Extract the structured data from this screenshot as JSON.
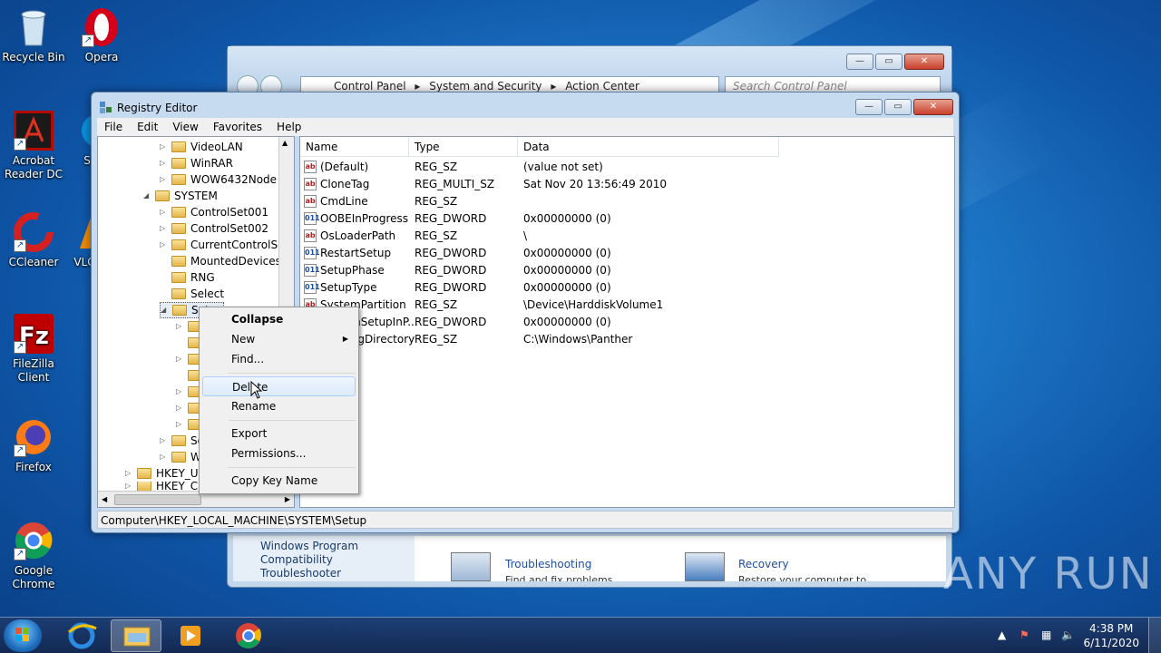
{
  "desktop": {
    "icons": [
      {
        "label": "Recycle Bin",
        "icon": "recycle-bin-icon"
      },
      {
        "label": "Opera",
        "icon": "opera-icon"
      },
      {
        "label": "Acrobat Reader DC",
        "icon": "acrobat-icon"
      },
      {
        "label": "S",
        "icon": "skype-icon"
      },
      {
        "label": "CCleaner",
        "icon": "ccleaner-icon"
      },
      {
        "label": "VLC",
        "icon": "vlc-icon"
      },
      {
        "label": "FileZilla Client",
        "icon": "filezilla-icon"
      },
      {
        "label": "Firefox",
        "icon": "firefox-icon"
      },
      {
        "label": "Google Chrome",
        "icon": "chrome-icon"
      }
    ]
  },
  "control_panel": {
    "address": [
      "Control Panel",
      "System and Security",
      "Action Center"
    ],
    "search_placeholder": "Search Control Panel",
    "left_link": "Windows Program Compatibility Troubleshooter",
    "troubleshooting": {
      "title": "Troubleshooting",
      "sub": "Find and fix problems"
    },
    "recovery": {
      "title": "Recovery",
      "sub": "Restore your computer to"
    }
  },
  "registry": {
    "title": "Registry Editor",
    "menu": [
      "File",
      "Edit",
      "View",
      "Favorites",
      "Help"
    ],
    "tree": [
      {
        "label": "VideoLAN",
        "exp": "▷"
      },
      {
        "label": "WinRAR",
        "exp": "▷"
      },
      {
        "label": "WOW6432Node",
        "exp": "▷"
      },
      {
        "label": "SYSTEM",
        "exp": "◢"
      },
      {
        "label": "ControlSet001",
        "exp": "▷"
      },
      {
        "label": "ControlSet002",
        "exp": "▷"
      },
      {
        "label": "CurrentControlSet",
        "exp": "▷"
      },
      {
        "label": "MountedDevices",
        "exp": ""
      },
      {
        "label": "RNG",
        "exp": ""
      },
      {
        "label": "Select",
        "exp": ""
      },
      {
        "label": "Setup",
        "exp": "◢"
      },
      {
        "label": "So",
        "exp": "▷"
      },
      {
        "label": "W",
        "exp": "▷"
      },
      {
        "label": "HKEY_US",
        "exp": "▷"
      },
      {
        "label": "HKEY_CU",
        "exp": "▷"
      }
    ],
    "columns": [
      "Name",
      "Type",
      "Data"
    ],
    "values": [
      {
        "name": "(Default)",
        "type": "REG_SZ",
        "data": "(value not set)",
        "kind": "ab"
      },
      {
        "name": "CloneTag",
        "type": "REG_MULTI_SZ",
        "data": "Sat Nov 20 13:56:49 2010",
        "kind": "ab"
      },
      {
        "name": "CmdLine",
        "type": "REG_SZ",
        "data": "",
        "kind": "ab"
      },
      {
        "name": "OOBEInProgress",
        "type": "REG_DWORD",
        "data": "0x00000000 (0)",
        "kind": "bin"
      },
      {
        "name": "OsLoaderPath",
        "type": "REG_SZ",
        "data": "\\",
        "kind": "ab"
      },
      {
        "name": "RestartSetup",
        "type": "REG_DWORD",
        "data": "0x00000000 (0)",
        "kind": "bin"
      },
      {
        "name": "SetupPhase",
        "type": "REG_DWORD",
        "data": "0x00000000 (0)",
        "kind": "bin"
      },
      {
        "name": "SetupType",
        "type": "REG_DWORD",
        "data": "0x00000000 (0)",
        "kind": "bin"
      },
      {
        "name": "SystemPartition",
        "type": "REG_SZ",
        "data": "\\Device\\HarddiskVolume1",
        "kind": "ab"
      },
      {
        "name": "SystemSetupInP...",
        "type": "REG_DWORD",
        "data": "0x00000000 (0)",
        "kind": "bin"
      },
      {
        "name": "WorkingDirectory",
        "type": "REG_SZ",
        "data": "C:\\Windows\\Panther",
        "kind": "ab"
      }
    ],
    "status": "Computer\\HKEY_LOCAL_MACHINE\\SYSTEM\\Setup"
  },
  "context_menu": {
    "items": [
      "Collapse",
      "New",
      "Find...",
      "Delete",
      "Rename",
      "Export",
      "Permissions...",
      "Copy Key Name"
    ],
    "highlighted": "Delete"
  },
  "taskbar": {
    "time": "4:38 PM",
    "date": "6/11/2020"
  },
  "watermark": "ANY RUN"
}
